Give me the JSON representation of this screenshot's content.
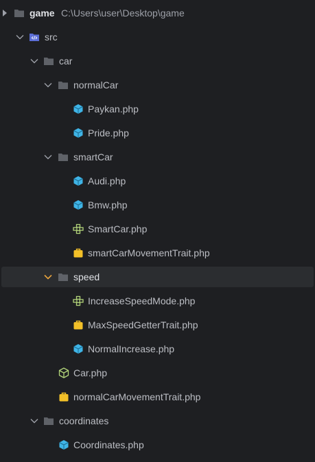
{
  "project": {
    "name": "game",
    "path": "C:\\Users\\user\\Desktop\\game"
  },
  "tree": {
    "src": "src",
    "car": "car",
    "normalCar": "normalCar",
    "paykan": "Paykan.php",
    "pride": "Pride.php",
    "smartCar": "smartCar",
    "audi": "Audi.php",
    "bmw": "Bmw.php",
    "smartCarFile": "SmartCar.php",
    "smartCarMovementTrait": "smartCarMovementTrait.php",
    "speed": "speed",
    "increaseSpeedMode": "IncreaseSpeedMode.php",
    "maxSpeedGetterTrait": "MaxSpeedGetterTrait.php",
    "normalIncrease": "NormalIncrease.php",
    "carFile": "Car.php",
    "normalCarMovementTrait": "normalCarMovementTrait.php",
    "coordinates": "coordinates",
    "coordinatesFile": "Coordinates.php"
  },
  "colors": {
    "background": "#1e1f22",
    "hover_row": "#2b2d30",
    "text": "#bcbec4",
    "folder": "#5f6268",
    "src_folder": "#5c6ed6",
    "class_icon": "#3fb4e6",
    "interface_icon": "#b2d47a",
    "trait_icon": "#f3c028",
    "chevron": "#9da0a8",
    "chevron_active": "#e8a33d"
  }
}
